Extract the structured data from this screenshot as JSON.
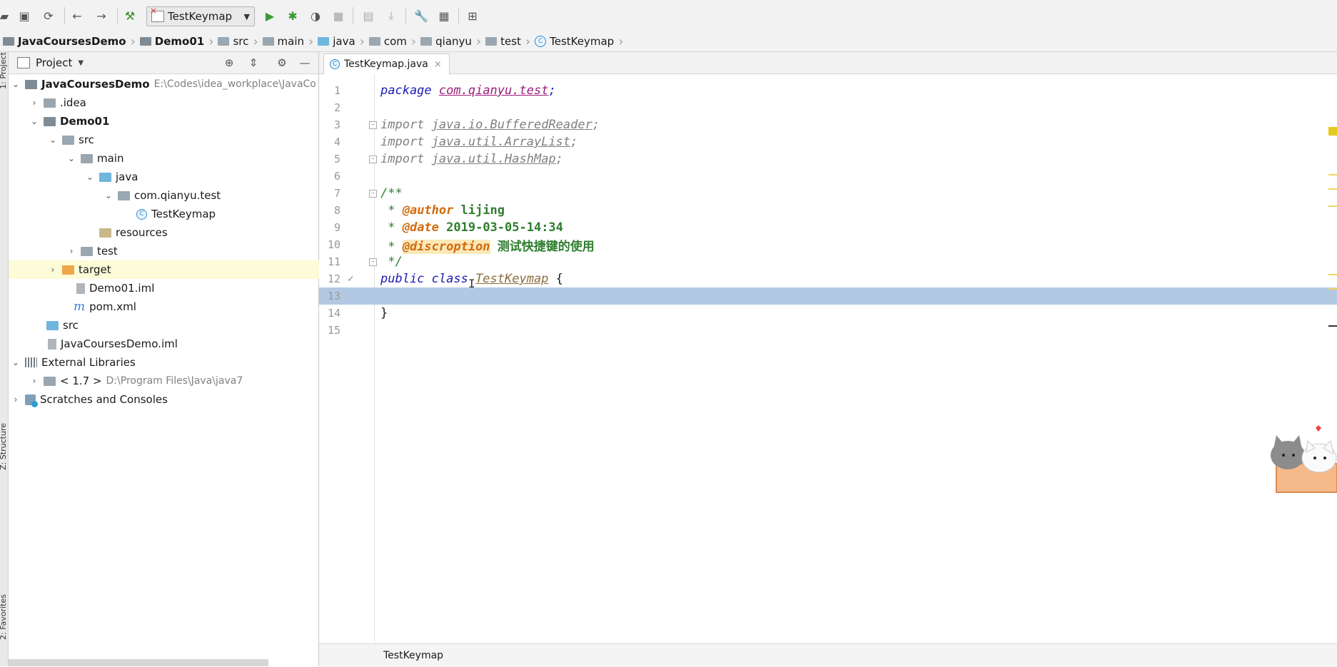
{
  "toolbar": {
    "run_config": "TestKeymap",
    "icons": [
      "open-icon",
      "save-icon",
      "sync-icon",
      "back-icon",
      "forward-icon",
      "build-icon",
      "run-icon",
      "debug-icon",
      "coverage-icon",
      "stop-icon",
      "build-artifact-icon",
      "download-icon",
      "settings-icon",
      "project-structure-icon",
      "vcs-icon"
    ]
  },
  "breadcrumb": {
    "items": [
      "JavaCoursesDemo",
      "Demo01",
      "src",
      "main",
      "java",
      "com",
      "qianyu",
      "test",
      "TestKeymap"
    ]
  },
  "side_tabs": {
    "project": "1: Project",
    "structure": "Z: Structure",
    "favorites": "2: Favorites"
  },
  "project_panel": {
    "title": "Project",
    "tree": [
      {
        "label": "JavaCoursesDemo",
        "path": "E:\\Codes\\idea_workplace\\JavaCo",
        "bold": true
      },
      {
        "label": ".idea"
      },
      {
        "label": "Demo01",
        "bold": true
      },
      {
        "label": "src"
      },
      {
        "label": "main"
      },
      {
        "label": "java"
      },
      {
        "label": "com.qianyu.test"
      },
      {
        "label": "TestKeymap"
      },
      {
        "label": "resources"
      },
      {
        "label": "test"
      },
      {
        "label": "target"
      },
      {
        "label": "Demo01.iml"
      },
      {
        "label": "pom.xml"
      },
      {
        "label": "src"
      },
      {
        "label": "JavaCoursesDemo.iml"
      },
      {
        "label": "External Libraries"
      },
      {
        "label": "< 1.7 >",
        "path": "D:\\Program Files\\Java\\java7"
      },
      {
        "label": "Scratches and Consoles"
      }
    ]
  },
  "editor": {
    "tab_label": "TestKeymap.java",
    "line_numbers": [
      "1",
      "2",
      "3",
      "4",
      "5",
      "6",
      "7",
      "8",
      "9",
      "10",
      "11",
      "12",
      "13",
      "14",
      "15"
    ],
    "code": {
      "l1_kw": "package",
      "l1_pkg": "com.qianyu.test",
      "semi": ";",
      "import_kw": "import",
      "l3_imp": "java.io.BufferedReader",
      "l4_imp": "java.util.ArrayList",
      "l5_imp": "java.util.HashMap",
      "l7": "/**",
      "l8_star": " * ",
      "l8_tag": "@author",
      "l8_val": " lijing",
      "l9_tag": "@date",
      "l9_val": " 2019-03-05-14:34",
      "l10_tag": "@discroption",
      "l10_val": " 测试快捷键的使用",
      "l11": " */",
      "l12_kw": "public class ",
      "l12_cls": "TestKeymap",
      "l12_brace": " {",
      "l14": "}"
    },
    "current_line": "13",
    "status_breadcrumb": "TestKeymap"
  },
  "colors": {
    "keyword": "#1b1bb3",
    "comment": "#2f7d2f",
    "doc_tag": "#d06a0c",
    "current_line": "#b3c9e3"
  }
}
